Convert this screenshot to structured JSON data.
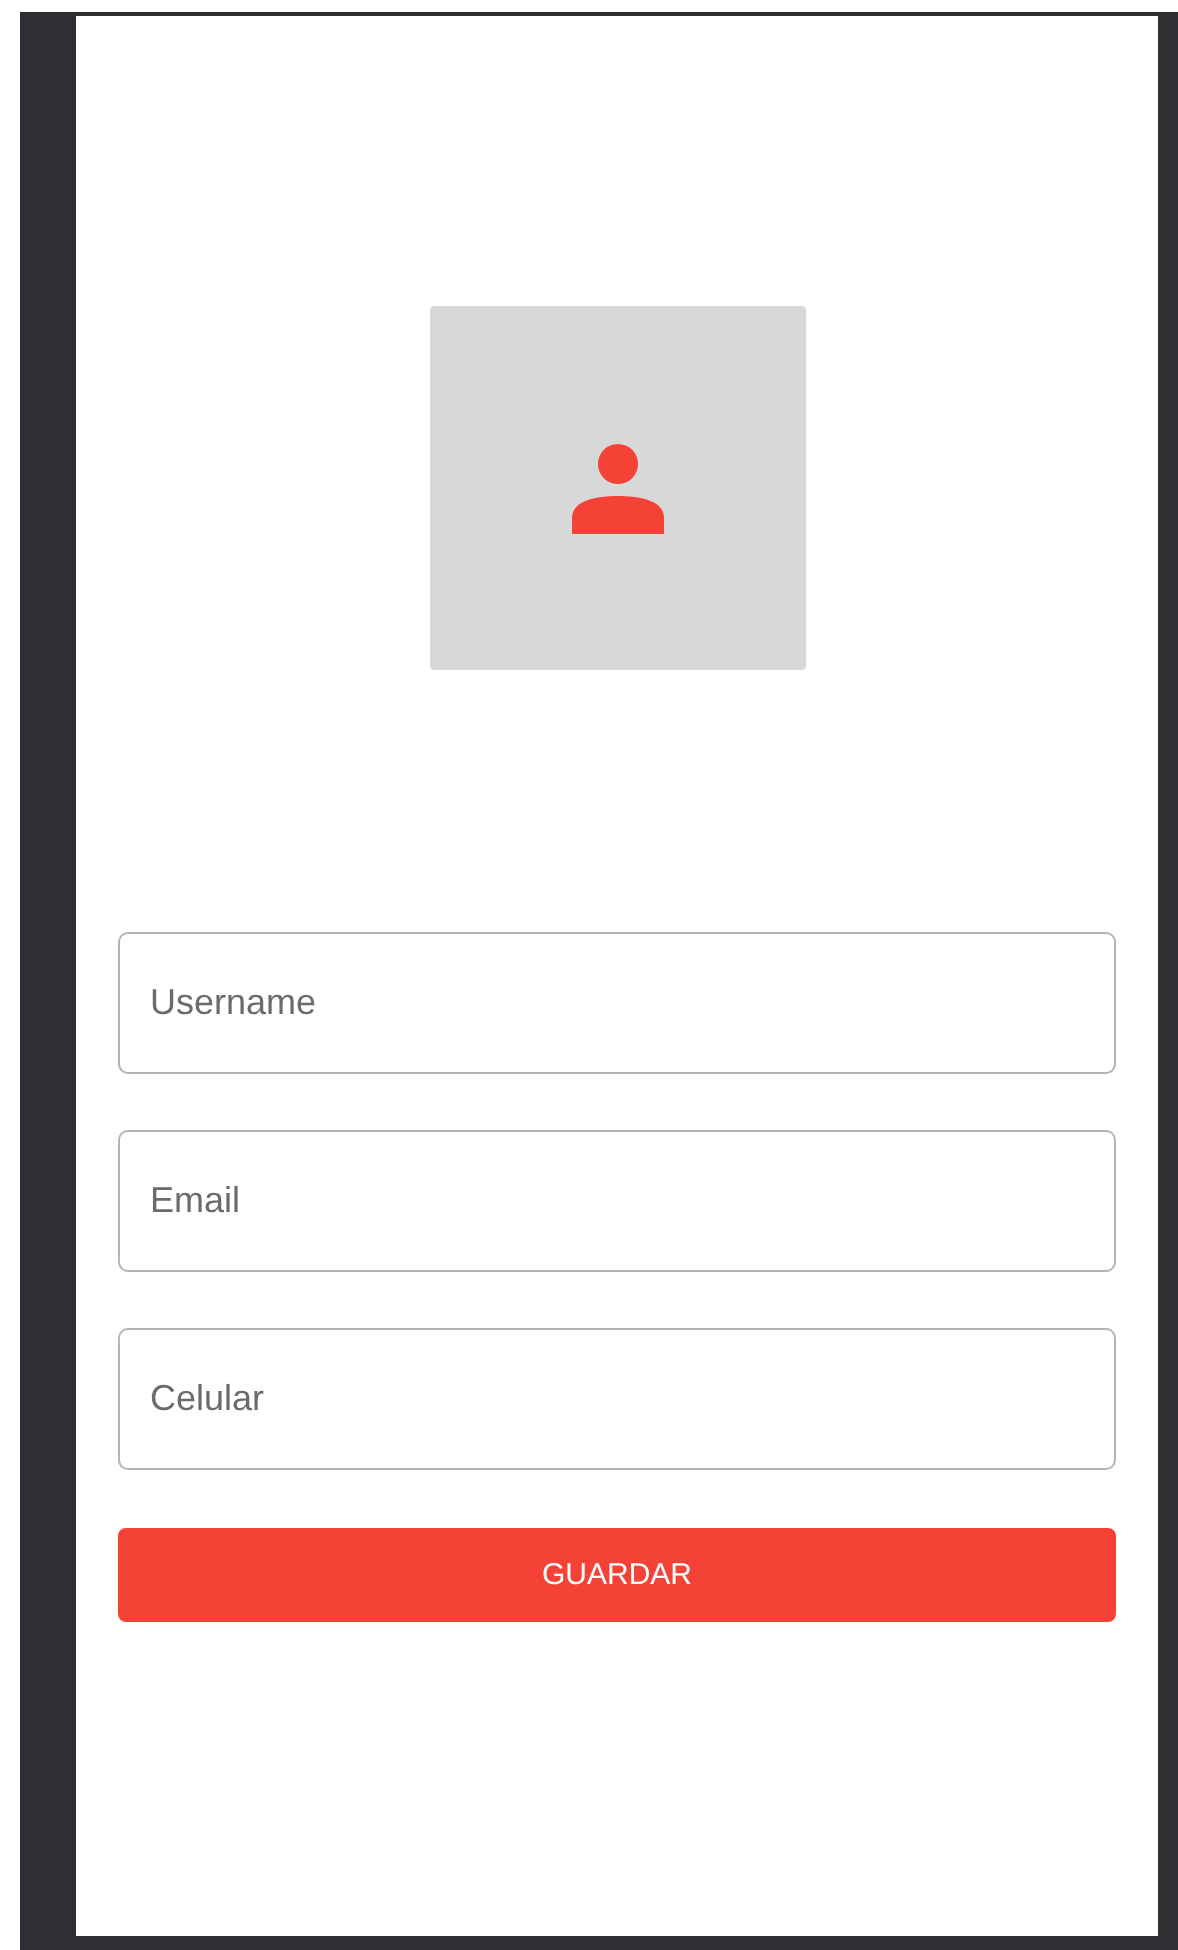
{
  "fields": [
    {
      "placeholder": "Username"
    },
    {
      "placeholder": "Email"
    },
    {
      "placeholder": "Celular"
    }
  ],
  "button": {
    "label": "GUARDAR"
  }
}
